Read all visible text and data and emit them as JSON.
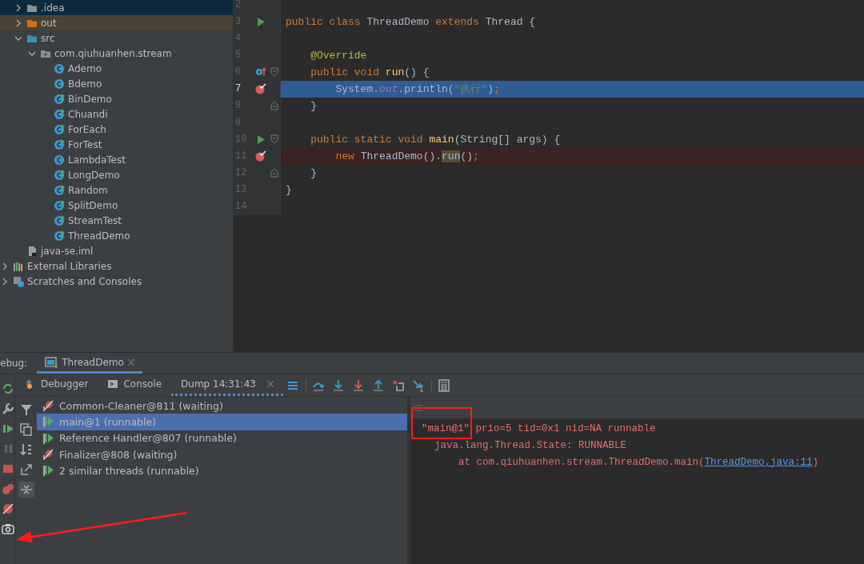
{
  "project_tree": {
    "project_children": [
      {
        "label": ".idea",
        "kind": "folder",
        "expanded": false,
        "selected": true
      },
      {
        "label": "out",
        "kind": "excluded-folder",
        "expanded": false,
        "selected": false
      },
      {
        "label": "src",
        "kind": "source-folder",
        "expanded": true,
        "selected": false,
        "children": [
          {
            "label": "com.qiuhuanhen.stream",
            "kind": "package",
            "expanded": true,
            "selected": false,
            "children": [
              {
                "label": "Ademo",
                "kind": "class",
                "selected": false
              },
              {
                "label": "Bdemo",
                "kind": "class",
                "selected": false
              },
              {
                "label": "BinDemo",
                "kind": "main-class",
                "selected": false
              },
              {
                "label": "Chuandi",
                "kind": "main-class",
                "selected": false
              },
              {
                "label": "ForEach",
                "kind": "main-class",
                "selected": false
              },
              {
                "label": "ForTest",
                "kind": "main-class",
                "selected": false
              },
              {
                "label": "LambdaTest",
                "kind": "class",
                "selected": false
              },
              {
                "label": "LongDemo",
                "kind": "main-class",
                "selected": false
              },
              {
                "label": "Random",
                "kind": "main-class",
                "selected": false
              },
              {
                "label": "SplitDemo",
                "kind": "main-class",
                "selected": false
              },
              {
                "label": "StreamTest",
                "kind": "main-class",
                "selected": false
              },
              {
                "label": "ThreadDemo",
                "kind": "main-class",
                "selected": false
              }
            ]
          }
        ]
      },
      {
        "label": "java-se.iml",
        "kind": "module-file",
        "selected": false
      }
    ],
    "top_level": [
      {
        "label": "External Libraries",
        "kind": "libraries",
        "expanded": false,
        "selected": false
      },
      {
        "label": "Scratches and Consoles",
        "kind": "scratches",
        "expanded": false,
        "selected": false
      }
    ]
  },
  "editor": {
    "lines": [
      {
        "number": "2"
      },
      {
        "number": "3",
        "run_marker": true,
        "tokens": [
          {
            "text": "public class ",
            "kind": "keyword"
          },
          {
            "text": "ThreadDemo ",
            "kind": "plain"
          },
          {
            "text": "extends ",
            "kind": "keyword"
          },
          {
            "text": "Thread {",
            "kind": "plain"
          }
        ]
      },
      {
        "number": "4"
      },
      {
        "number": "5",
        "tokens": [
          {
            "text": "    @Override",
            "kind": "annotation"
          }
        ]
      },
      {
        "number": "6",
        "override_marker": true,
        "fold_start": true,
        "tokens": [
          {
            "text": "    public void ",
            "kind": "keyword"
          },
          {
            "text": "run",
            "kind": "method"
          },
          {
            "text": "() {",
            "kind": "plain"
          }
        ]
      },
      {
        "number": "7",
        "breakpoint": true,
        "current": true,
        "tokens": [
          {
            "text": "        System.",
            "kind": "plain"
          },
          {
            "text": "out",
            "kind": "static-field"
          },
          {
            "text": ".println(",
            "kind": "plain"
          },
          {
            "text": "\"执行\"",
            "kind": "string"
          },
          {
            "text": ")",
            "kind": "plain"
          },
          {
            "text": ";",
            "kind": "keyword"
          }
        ]
      },
      {
        "number": "8",
        "fold_end": true,
        "tokens": [
          {
            "text": "    }",
            "kind": "plain"
          }
        ]
      },
      {
        "number": "9"
      },
      {
        "number": "10",
        "run_marker": true,
        "fold_start": true,
        "tokens": [
          {
            "text": "    public static void ",
            "kind": "keyword"
          },
          {
            "text": "main",
            "kind": "method"
          },
          {
            "text": "(String[] args) {",
            "kind": "plain"
          }
        ]
      },
      {
        "number": "11",
        "breakpoint": true,
        "tokens": [
          {
            "text": "        new ",
            "kind": "keyword"
          },
          {
            "text": "ThreadDemo().",
            "kind": "plain"
          },
          {
            "text": "run",
            "kind": "usage"
          },
          {
            "text": "()",
            "kind": "plain"
          },
          {
            "text": ";",
            "kind": "keyword"
          }
        ]
      },
      {
        "number": "12",
        "fold_end": true,
        "tokens": [
          {
            "text": "    }",
            "kind": "plain"
          }
        ]
      },
      {
        "number": "13",
        "tokens": [
          {
            "text": "}",
            "kind": "plain"
          }
        ]
      },
      {
        "number": "14"
      }
    ]
  },
  "debug": {
    "label": "ebug:",
    "session_tab": {
      "label": "ThreadDemo",
      "selected": true
    },
    "side_tools": [
      {
        "kind": "rerun"
      },
      {
        "kind": "settings"
      },
      {
        "kind": "resume"
      },
      {
        "kind": "pause"
      },
      {
        "kind": "stop"
      },
      {
        "kind": "breakpoints"
      },
      {
        "kind": "mute"
      },
      {
        "kind": "camera"
      }
    ],
    "arrow_to_camera": true,
    "tabs": [
      {
        "label": "Debugger",
        "kind": "debugger",
        "selected": false
      },
      {
        "label": "Console",
        "kind": "console",
        "selected": false
      },
      {
        "label": "Dump 14:31:43",
        "kind": "dump",
        "selected": true,
        "closable": true
      }
    ],
    "toolbar": [
      {
        "kind": "menu"
      },
      {
        "kind": "step-over"
      },
      {
        "kind": "step-into"
      },
      {
        "kind": "force-step-into"
      },
      {
        "kind": "step-out"
      },
      {
        "kind": "drop-frame"
      },
      {
        "kind": "run-to-cursor"
      },
      {
        "kind": "evaluate"
      }
    ],
    "thread_tools": [
      {
        "kind": "filter",
        "selected": false
      },
      {
        "kind": "copy",
        "selected": false
      },
      {
        "kind": "sort",
        "selected": false
      },
      {
        "kind": "export",
        "selected": false
      },
      {
        "kind": "collapse",
        "selected": true
      }
    ],
    "threads": [
      {
        "label": "Common-Cleaner@811 (waiting)",
        "kind": "waiting",
        "selected": false
      },
      {
        "label": "main@1 (runnable)",
        "kind": "runnable",
        "selected": true
      },
      {
        "label": "Reference Handler@807 (runnable)",
        "kind": "runnable",
        "selected": false
      },
      {
        "label": "Finalizer@808 (waiting)",
        "kind": "waiting",
        "selected": false
      },
      {
        "label": "2 similar threads (runnable)",
        "kind": "runnable",
        "selected": false
      }
    ],
    "dump": [
      {
        "kind": "header",
        "parts": [
          {
            "text": "\"main@1\"",
            "boxed": true
          },
          {
            "text": " prio=5 tid=0x1 nid=NA runnable"
          }
        ]
      },
      {
        "kind": "state",
        "parts": [
          {
            "text": "java.lang.Thread.State: RUNNABLE"
          }
        ]
      },
      {
        "kind": "frame",
        "parts": [
          {
            "text": "at com.qiuhuanhen.stream.ThreadDemo.main("
          },
          {
            "text": "ThreadDemo.java:11",
            "link": true
          },
          {
            "text": ")"
          }
        ]
      }
    ]
  }
}
